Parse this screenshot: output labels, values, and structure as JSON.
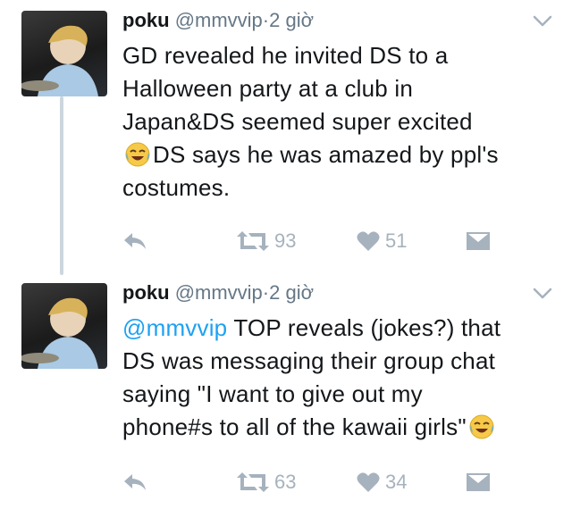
{
  "tweets": [
    {
      "name": "poku",
      "handle": "@mmvvip",
      "separator": "·",
      "time": "2 giờ",
      "text_lines": [
        "GD revealed he invited DS to a",
        "Halloween party at a club in",
        "Japan&DS seemed super excited",
        "DS says he was amazed by ppl's",
        "costumes."
      ],
      "emoji": "face-with-tears-of-joy",
      "retweets": "93",
      "likes": "51"
    },
    {
      "name": "poku",
      "handle": "@mmvvip",
      "separator": "·",
      "time": "2 giờ",
      "mention": "@mmvvip",
      "text_lines": [
        " TOP reveals (jokes?) that",
        "DS was messaging their group chat",
        "saying \"I want to give out my",
        "phone#s to all of the kawaii girls\""
      ],
      "emoji": "face-with-tears-of-joy",
      "retweets": "63",
      "likes": "34"
    }
  ],
  "colors": {
    "accent": "#1da1f2",
    "muted": "#657786",
    "icon": "#a6b2bd",
    "thread_line": "#ccd6dd"
  },
  "icons": [
    "chevron-down-icon",
    "reply-icon",
    "retweet-icon",
    "heart-icon",
    "direct-message-icon"
  ]
}
